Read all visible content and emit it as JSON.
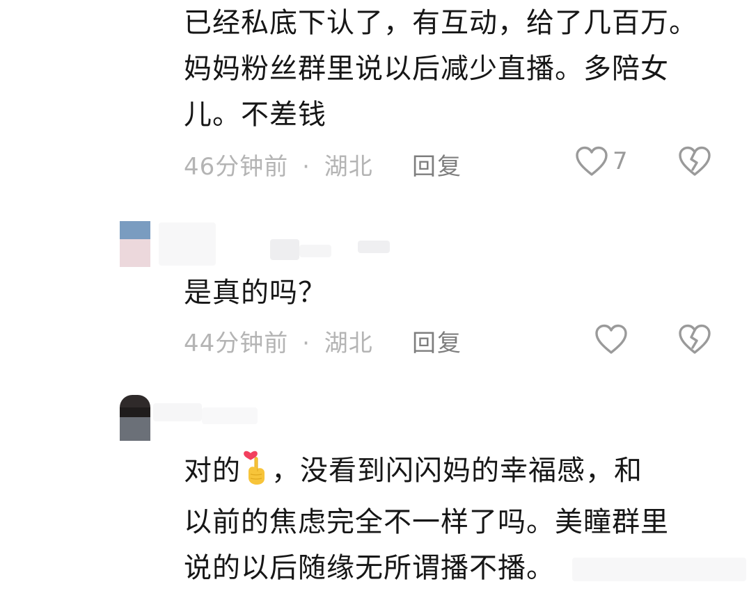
{
  "comments": [
    {
      "lines": [
        "已经私底下认了，有互动，给了几百万。",
        "妈妈粉丝群里说以后减少直播。多陪女",
        "儿。不差钱"
      ],
      "time": "46分钟前",
      "separator": "·",
      "location": "湖北",
      "reply_label": "回复",
      "like_count": "7"
    },
    {
      "lines": [
        "是真的吗？"
      ],
      "time": "44分钟前",
      "separator": "·",
      "location": "湖北",
      "reply_label": "回复",
      "like_count": ""
    },
    {
      "line1_before": "对的",
      "line1_after": "，没看到闪闪妈的幸福感，和",
      "lines_rest": [
        "以前的焦虑完全不一样了吗。美瞳群里",
        "说的以后随缘无所谓播不播。"
      ],
      "emoji": "finger-heart-emoji"
    }
  ],
  "icons": {
    "like": "heart-outline-icon",
    "dislike": "broken-heart-icon"
  },
  "colors": {
    "text": "#161616",
    "meta": "#b4b4b4",
    "reply": "#7e7e7e",
    "icon": "#9a9a9a"
  }
}
